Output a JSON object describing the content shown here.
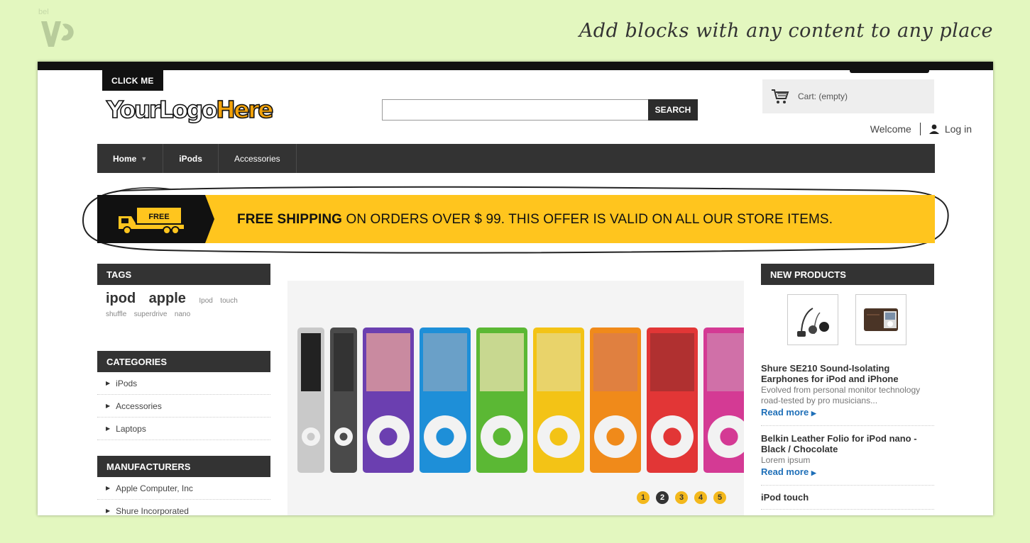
{
  "slide": {
    "headline": "Add blocks with any content to any place",
    "brand_mark": "bel"
  },
  "header": {
    "logo_badge": "CLICK ME",
    "logo_your": "YourLogo",
    "logo_here": "Here",
    "search_value": "",
    "search_button": "SEARCH",
    "cart_label": "Cart: (empty)",
    "welcome": "Welcome",
    "login": "Log in"
  },
  "nav": {
    "items": [
      {
        "label": "Home"
      },
      {
        "label": "iPods"
      },
      {
        "label": "Accessories"
      }
    ]
  },
  "banner": {
    "truck_label": "FREE",
    "bold_text": "FREE SHIPPING",
    "rest_text": " ON ORDERS OVER $ 99. THIS OFFER IS VALID ON ALL OUR STORE ITEMS.",
    "accent": "#ffc51e"
  },
  "tags": {
    "title": "TAGS",
    "items": [
      "ipod",
      "apple",
      "Ipod",
      "touch",
      "shuffle",
      "superdrive",
      "nano"
    ]
  },
  "categories": {
    "title": "CATEGORIES",
    "items": [
      "iPods",
      "Accessories",
      "Laptops"
    ]
  },
  "manufacturers": {
    "title": "MANUFACTURERS",
    "items": [
      "Apple Computer, Inc",
      "Shure Incorporated"
    ]
  },
  "slider": {
    "dots": [
      "1",
      "2",
      "3",
      "4",
      "5"
    ],
    "active": "2",
    "ipod_colors": [
      "#c9c9c9",
      "#4a4a4a",
      "#6b3fb0",
      "#1e8fd8",
      "#5bb834",
      "#f3c316",
      "#f08a1a",
      "#e23636",
      "#d43a94"
    ]
  },
  "new_products": {
    "title": "NEW PRODUCTS",
    "items": [
      {
        "title": "Shure SE210 Sound-Isolating Earphones for iPod and iPhone",
        "desc": "Evolved from personal monitor technology road-tested by pro musicians...",
        "link": "Read more"
      },
      {
        "title": "Belkin Leather Folio for iPod nano - Black / Chocolate",
        "desc": "Lorem ipsum",
        "link": "Read more"
      },
      {
        "title": "iPod touch",
        "desc": "",
        "link": ""
      }
    ]
  }
}
